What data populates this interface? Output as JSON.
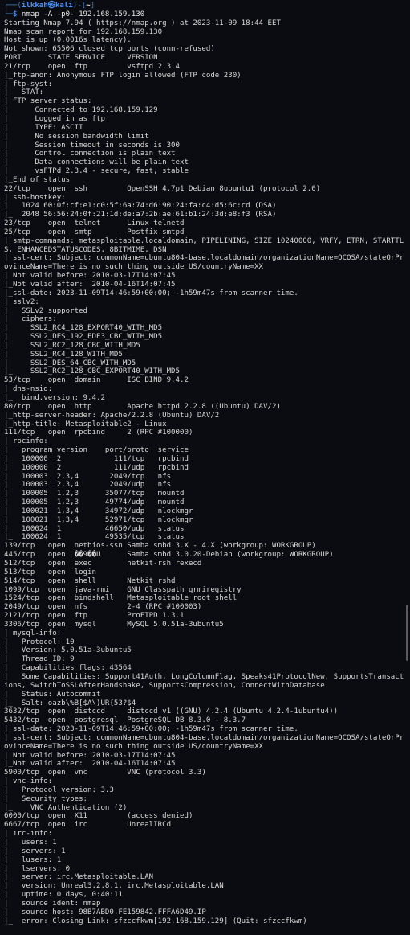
{
  "prompt": {
    "line1_prefix": "┌──(",
    "user": "ilkkah",
    "at_symbol": "㉿",
    "host": "kali",
    "line1_mid": ")-[",
    "dir": "~",
    "line1_suffix": "]",
    "line2_prefix": "└─",
    "dollar": "$ ",
    "command": "nmap -A -p0- 192.168.159.130"
  },
  "output_lines": [
    "Starting Nmap 7.94 ( https://nmap.org ) at 2023-11-09 18:44 EET",
    "Nmap scan report for 192.168.159.130",
    "Host is up (0.0016s latency).",
    "Not shown: 65506 closed tcp ports (conn-refused)",
    "PORT      STATE SERVICE     VERSION",
    "21/tcp    open  ftp         vsftpd 2.3.4",
    "|_ftp-anon: Anonymous FTP login allowed (FTP code 230)",
    "| ftp-syst:",
    "|   STAT:",
    "| FTP server status:",
    "|      Connected to 192.168.159.129",
    "|      Logged in as ftp",
    "|      TYPE: ASCII",
    "|      No session bandwidth limit",
    "|      Session timeout in seconds is 300",
    "|      Control connection is plain text",
    "|      Data connections will be plain text",
    "|      vsFTPd 2.3.4 - secure, fast, stable",
    "|_End of status",
    "22/tcp    open  ssh         OpenSSH 4.7p1 Debian 8ubuntu1 (protocol 2.0)",
    "| ssh-hostkey:",
    "|   1024 60:0f:cf:e1:c0:5f:6a:74:d6:90:24:fa:c4:d5:6c:cd (DSA)",
    "|_  2048 56:56:24:0f:21:1d:de:a7:2b:ae:61:b1:24:3d:e8:f3 (RSA)",
    "23/tcp    open  telnet      Linux telnetd",
    "25/tcp    open  smtp        Postfix smtpd",
    "|_smtp-commands: metasploitable.localdomain, PIPELINING, SIZE 10240000, VRFY, ETRN, STARTTLS, ENHANCEDSTATUSCODES, 8BITMIME, DSN",
    "| ssl-cert: Subject: commonName=ubuntu804-base.localdomain/organizationName=OCOSA/stateOrProvinceName=There is no such thing outside US/countryName=XX",
    "| Not valid before: 2010-03-17T14:07:45",
    "|_Not valid after:  2010-04-16T14:07:45",
    "|_ssl-date: 2023-11-09T14:46:59+00:00; -1h59m47s from scanner time.",
    "| sslv2:",
    "|   SSLv2 supported",
    "|   ciphers:",
    "|     SSL2_RC4_128_EXPORT40_WITH_MD5",
    "|     SSL2_DES_192_EDE3_CBC_WITH_MD5",
    "|     SSL2_RC2_128_CBC_WITH_MD5",
    "|     SSL2_RC4_128_WITH_MD5",
    "|     SSL2_DES_64_CBC_WITH_MD5",
    "|_    SSL2_RC2_128_CBC_EXPORT40_WITH_MD5",
    "53/tcp    open  domain      ISC BIND 9.4.2",
    "| dns-nsid:",
    "|_  bind.version: 9.4.2",
    "80/tcp    open  http        Apache httpd 2.2.8 ((Ubuntu) DAV/2)",
    "|_http-server-header: Apache/2.2.8 (Ubuntu) DAV/2",
    "|_http-title: Metasploitable2 - Linux",
    "111/tcp   open  rpcbind     2 (RPC #100000)",
    "| rpcinfo:",
    "|   program version    port/proto  service",
    "|   100000  2            111/tcp   rpcbind",
    "|   100000  2            111/udp   rpcbind",
    "|   100003  2,3,4       2049/tcp   nfs",
    "|   100003  2,3,4       2049/udp   nfs",
    "|   100005  1,2,3      35077/tcp   mountd",
    "|   100005  1,2,3      49774/udp   mountd",
    "|   100021  1,3,4      34972/udp   nlockmgr",
    "|   100021  1,3,4      52971/tcp   nlockmgr",
    "|   100024  1          46650/udp   status",
    "|_  100024  1          49535/tcp   status",
    "139/tcp   open  netbios-ssn Samba smbd 3.X - 4.X (workgroup: WORKGROUP)",
    "445/tcp   open  ��9��U      Samba smbd 3.0.20-Debian (workgroup: WORKGROUP)",
    "512/tcp   open  exec        netkit-rsh rexecd",
    "513/tcp   open  login",
    "514/tcp   open  shell       Netkit rshd",
    "1099/tcp  open  java-rmi    GNU Classpath grmiregistry",
    "1524/tcp  open  bindshell   Metasploitable root shell",
    "2049/tcp  open  nfs         2-4 (RPC #100003)",
    "2121/tcp  open  ftp         ProFTPD 1.3.1",
    "3306/tcp  open  mysql       MySQL 5.0.51a-3ubuntu5",
    "| mysql-info:",
    "|   Protocol: 10",
    "|   Version: 5.0.51a-3ubuntu5",
    "|   Thread ID: 9",
    "|   Capabilities flags: 43564",
    "|   Some Capabilities: Support41Auth, LongColumnFlag, Speaks41ProtocolNew, SupportsTransactions, SwitchToSSLAfterHandshake, SupportsCompression, ConnectWithDatabase",
    "|   Status: Autocommit",
    "|_  Salt: oazb\\%B[$A\\)UR{53?$4",
    "3632/tcp  open  distccd     distccd v1 ((GNU) 4.2.4 (Ubuntu 4.2.4-1ubuntu4))",
    "5432/tcp  open  postgresql  PostgreSQL DB 8.3.0 - 8.3.7",
    "|_ssl-date: 2023-11-09T14:46:59+00:00; -1h59m47s from scanner time.",
    "| ssl-cert: Subject: commonName=ubuntu804-base.localdomain/organizationName=OCOSA/stateOrProvinceName=There is no such thing outside US/countryName=XX",
    "| Not valid before: 2010-03-17T14:07:45",
    "|_Not valid after:  2010-04-16T14:07:45",
    "5900/tcp  open  vnc         VNC (protocol 3.3)",
    "| vnc-info:",
    "|   Protocol version: 3.3",
    "|   Security types:",
    "|_    VNC Authentication (2)",
    "6000/tcp  open  X11         (access denied)",
    "6667/tcp  open  irc         UnrealIRCd",
    "| irc-info:",
    "|   users: 1",
    "|   servers: 1",
    "|   lusers: 1",
    "|   lservers: 0",
    "|   server: irc.Metasploitable.LAN",
    "|   version: Unreal3.2.8.1. irc.Metasploitable.LAN",
    "|   uptime: 0 days, 0:40:11",
    "|   source ident: nmap",
    "|   source host: 98B7ABD0.FE159842.FFFA6D49.IP",
    "|_  error: Closing Link: sfzccfkwm[192.168.159.129] (Quit: sfzccfkwm)"
  ]
}
